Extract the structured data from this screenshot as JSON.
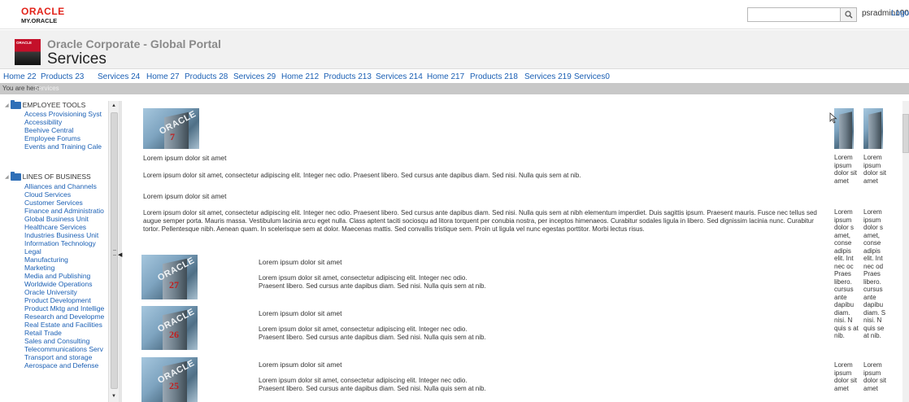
{
  "topbar": {
    "logo_brand": "ORACLE",
    "logo_sub": "MY.ORACLE",
    "search_value": "",
    "search_icon": "search-icon",
    "user": "psradmin190",
    "logout": "Logou"
  },
  "header": {
    "logo_text": "ORACLE",
    "portal_title": "Oracle Corporate - Global Portal",
    "page_title": "Services"
  },
  "nav": {
    "items": [
      "Home 22",
      "Products 23",
      "Services 24",
      "Home 27",
      "Products 28",
      "Services 29",
      "Home 212",
      "Products 213",
      "Services 214",
      "Home 217",
      "Products 218",
      "Services 219",
      "Services0"
    ]
  },
  "breadcrumb": {
    "label": "You are here:",
    "current": "Services"
  },
  "sidebar": {
    "employee_tools": "EMPLOYEE TOOLS",
    "employee_items": [
      "Access Provisioning Syst",
      "Accessibility",
      "Beehive Central",
      "Employee Forums",
      "Events and Training Cale"
    ],
    "lines_of_business": "LINES OF BUSINESS",
    "lob_items": [
      "Alliances and Channels",
      "Cloud Services",
      "Customer Services",
      "Finance and Administratio",
      "Global Business Unit",
      "Healthcare Services",
      "Industries Business Unit",
      "Information Technology",
      "Legal",
      "Manufacturing",
      "Marketing",
      "Media and Publishing",
      "Worldwide Operations",
      "Oracle University",
      "Product Development",
      "Product Mktg and Intellige",
      "Research and Developme",
      "Real Estate and Facilities",
      "Retail Trade",
      "Sales and Consulting",
      "Telecommunications Serv",
      "Transport and storage",
      "Aerospace and Defense"
    ]
  },
  "main": {
    "thumb_brand": "ORACLE",
    "top_thumb_number": "7",
    "lorem_short": "Lorem ipsum dolor sit amet",
    "lorem_one_line": "Lorem ipsum dolor sit amet, consectetur adipiscing elit. Integer nec odio. Praesent libero. Sed cursus ante dapibus diam. Sed nisi. Nulla quis sem at nib.",
    "lorem_long": "Lorem ipsum dolor sit amet, consectetur adipiscing elit. Integer nec odio. Praesent libero. Sed cursus ante dapibus diam. Sed nisi. Nulla quis sem at nibh elementum imperdiet. Duis sagittis ipsum. Praesent mauris. Fusce nec tellus sed augue semper porta. Mauris massa. Vestibulum lacinia arcu eget nulla. Class aptent taciti sociosqu ad litora torquent per conubia nostra, per inceptos himenaeos. Curabitur sodales ligula in libero. Sed dignissim lacinia nunc. Curabitur tortor. Pellentesque nibh. Aenean quam. In scelerisque sem at dolor. Maecenas mattis. Sed convallis tristique sem. Proin ut ligula vel nunc egestas porttitor. Morbi lectus risus.",
    "list_items": [
      {
        "number": "27",
        "title": "Lorem ipsum dolor sit amet",
        "body": "Lorem ipsum dolor sit amet, consectetur adipiscing elit. Integer nec odio. Praesent libero. Sed cursus ante dapibus diam. Sed nisi. Nulla quis sem at nib."
      },
      {
        "number": "26",
        "title": "Lorem ipsum dolor sit amet",
        "body": "Lorem ipsum dolor sit amet, consectetur adipiscing elit. Integer nec odio. Praesent libero. Sed cursus ante dapibus diam. Sed nisi. Nulla quis sem at nib."
      },
      {
        "number": "25",
        "title": "Lorem ipsum dolor sit amet",
        "body": "Lorem ipsum dolor sit amet, consectetur adipiscing elit. Integer nec odio. Praesent libero. Sed cursus ante dapibus diam. Sed nisi. Nulla quis sem at nib."
      }
    ],
    "right_columns": [
      {
        "short": "Lorem ipsum dolor sit amet",
        "body": "Lorem ipsum dolor s amet, conse adipis elit. Int nec oc Praes libero. cursus ante dapibu diam. nisi. N quis s at nib.",
        "short2": "Lorem ipsum dolor sit amet"
      },
      {
        "short": "Lorem ipsum dolor sit amet",
        "body": "Lorem ipsum dolor s amet, conse adipis elit. Int nec od Praes libero. cursus ante dapibu diam. S nisi. N quis se at nib.",
        "short2": "Lorem ipsum dolor sit amet"
      }
    ]
  },
  "colors": {
    "accent_red": "#e2231a",
    "link_blue": "#1a5fb4",
    "folder_blue": "#2f6fb7",
    "breadcrumb_gray": "#c8c8c8"
  }
}
